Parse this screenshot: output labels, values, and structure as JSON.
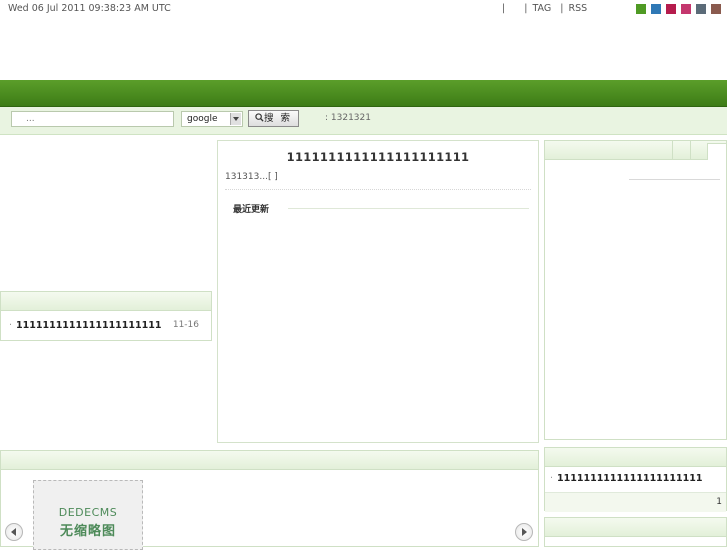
{
  "topbar": {
    "date": "Wed 06 Jul 2011 09:38:23 AM UTC",
    "sep1": "|",
    "sep2": "|",
    "tag_link": "TAG",
    "sep3": "|",
    "rss_link": "RSS",
    "theme_colors": [
      "#4f9a24",
      "#2f78b5",
      "#b51c4d",
      "#c4376e",
      "#5b6b78",
      "#8a5a4e"
    ]
  },
  "search": {
    "placeholder": "...",
    "engine": "google",
    "button_label": "搜 索",
    "hot_keywords": ": 1321321"
  },
  "left_panel": {
    "item_title": "1111111111111111111111",
    "item_date": "11-16"
  },
  "article": {
    "title": "1111111111111111111111",
    "summary": "131313...[ ]",
    "latest_heading": "最近更新"
  },
  "right_panel2": {
    "item_title": "1111111111111111111111",
    "page": "1"
  },
  "thumbnail": {
    "brand": "DEDECMS",
    "caption": "无缩略图"
  }
}
